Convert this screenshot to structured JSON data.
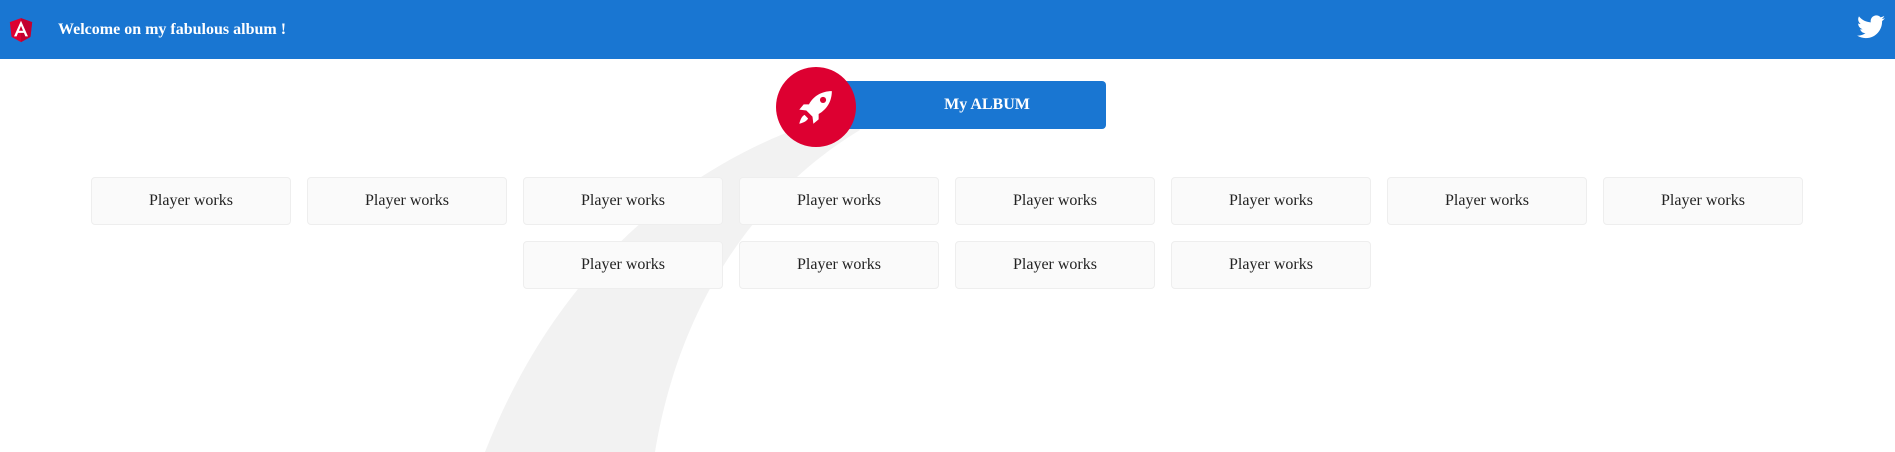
{
  "toolbar": {
    "title": "Welcome on my fabulous album !",
    "logo_icon": "angular-logo-icon",
    "twitter_icon": "twitter-icon",
    "background_color": "#1976d2"
  },
  "hero": {
    "button_label": "My ALBUM",
    "rocket_icon": "rocket-icon",
    "accent_color": "#dd0031"
  },
  "cards": {
    "row1": [
      "Player works",
      "Player works",
      "Player works",
      "Player works",
      "Player works",
      "Player works",
      "Player works",
      "Player works"
    ],
    "row2": [
      "Player works",
      "Player works",
      "Player works",
      "Player works"
    ]
  }
}
